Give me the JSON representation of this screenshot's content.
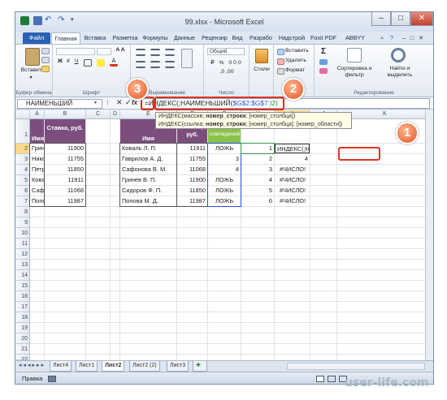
{
  "window": {
    "title": "99.xlsx - Microsoft Excel"
  },
  "tabs": [
    "Файл",
    "Главная",
    "Вставка",
    "Разметка",
    "Формулы",
    "Данные",
    "Рецензир",
    "Вид",
    "Разрабо",
    "Надстрой",
    "Foxit PDF",
    "ABBYY PDF"
  ],
  "ribbon": {
    "paste": "Вставить",
    "clipboard": "Буфер обмена",
    "font": "Шрифт",
    "align": "Выравнивание",
    "number": "Число",
    "number_format": "Общий",
    "styles": "Стили",
    "insert": "Вставить",
    "delete": "Удалить",
    "format": "Формат",
    "sort": "Сортировка и фильтр",
    "find": "Найти и выделить",
    "editing": "Редактирование"
  },
  "formula_bar": {
    "name_box": "НАИМЕНЬШИЙ",
    "fx": "fx",
    "formula_prefix": "=ИНДЕКС(;НАИМЕНЬШИЙ(",
    "formula_range": "$G$2:$G$7",
    "formula_suffix": ";I2)"
  },
  "tooltip": {
    "line1_a": "ИНДЕКС(массив; ",
    "line1_b": "номер_строки",
    "line1_c": "; [номер_столбца])",
    "line2_a": "ИНДЕКС(ссылка; ",
    "line2_b": "номер_строки",
    "line2_c": "; [номер_столбца]; [номер_области])"
  },
  "columns": [
    "A",
    "B",
    "C",
    "D",
    "E",
    "F",
    "G",
    "H",
    "I",
    "J",
    "K"
  ],
  "rows": [
    "1",
    "2",
    "3",
    "4",
    "5",
    "6",
    "7",
    "8",
    "9",
    "10",
    "11",
    "12",
    "13",
    "14",
    "15",
    "16",
    "17",
    "18",
    "19",
    "20",
    "21",
    "22",
    "23",
    "24",
    "25"
  ],
  "table1": {
    "h_name": "Имя",
    "h_rate": "Ставка, руб.",
    "rows": [
      [
        "Гринев В. П.",
        "11900"
      ],
      [
        "Николаев А. Д.",
        "11755"
      ],
      [
        "Петров Ф. Л.",
        "11850"
      ],
      [
        "Коваль Л. П.",
        "11911"
      ],
      [
        "Сафронова В. М.",
        "11068"
      ],
      [
        "Попова М. Д.",
        "11987"
      ]
    ]
  },
  "table2": {
    "h_name": "Имя",
    "h_rate": "Ставка, руб.",
    "rows": [
      [
        "Коваль Л. П.",
        "11911"
      ],
      [
        "Гаврилов А. Д.",
        "11755"
      ],
      [
        "Сафонова В. М.",
        "11068"
      ],
      [
        "Гринев В. П.",
        "11900"
      ],
      [
        "Сидоров Ф. П.",
        "11850"
      ],
      [
        "Попова М. Д.",
        "11987"
      ]
    ]
  },
  "col_g": {
    "header": "Количество совпадений",
    "values": [
      "ЛОЖЬ",
      "3",
      "4",
      "ЛОЖЬ",
      "ЛОЖЬ",
      "ЛОЖЬ"
    ]
  },
  "col_h": [
    "1",
    "2",
    "3",
    "4",
    "5",
    "6"
  ],
  "col_i": [
    "ИНДЕКС(;НА",
    "4",
    "#ЧИСЛО!",
    "#ЧИСЛО!",
    "#ЧИСЛО!",
    "#ЧИСЛО!"
  ],
  "sheets": [
    "Лист4",
    "Лист1",
    "Лист2",
    "Лист2 (2)",
    "Лист3"
  ],
  "active_sheet": "Лист2",
  "status": "Правка",
  "watermark": "user-life.com",
  "badges": [
    "1",
    "2",
    "3"
  ]
}
